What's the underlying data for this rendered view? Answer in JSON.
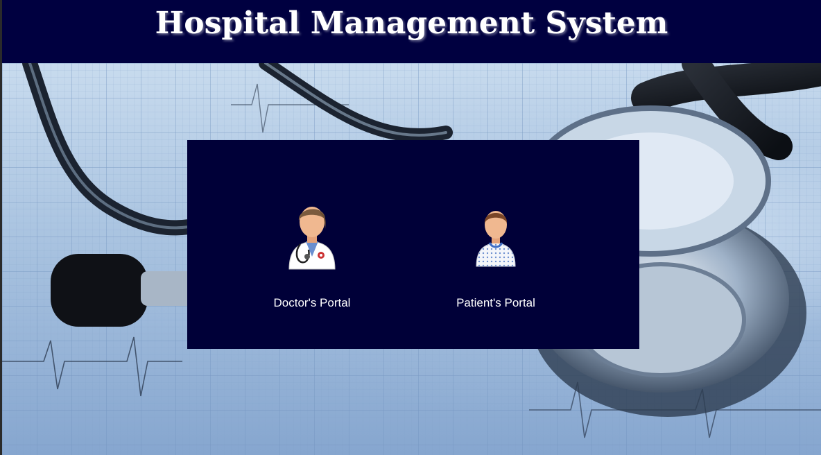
{
  "header": {
    "title": "Hospital Management System"
  },
  "portals": [
    {
      "label": "Doctor's Portal",
      "icon": "doctor-icon"
    },
    {
      "label": "Patient's Portal",
      "icon": "patient-icon"
    }
  ],
  "colors": {
    "header_bg": "#000040",
    "panel_bg": "#000038",
    "text": "#ffffff"
  },
  "background_image": "stethoscope-on-ecg-paper"
}
